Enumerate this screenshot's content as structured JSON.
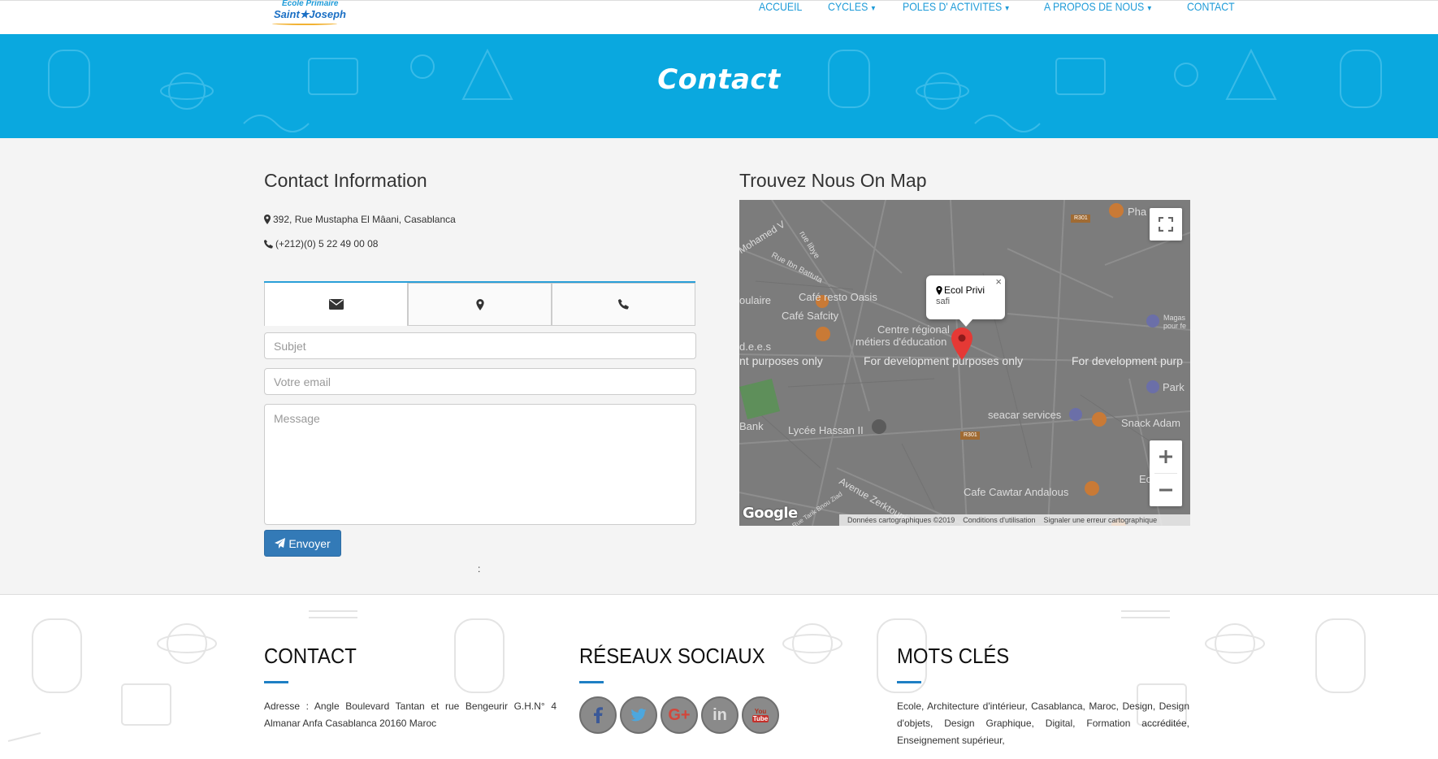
{
  "logo": {
    "line1": "Ecole Primaire",
    "line2": "Saint★Joseph"
  },
  "nav": {
    "items": [
      {
        "label": "ACCUEIL",
        "dropdown": false
      },
      {
        "label": "CYCLES",
        "dropdown": true
      },
      {
        "label": "POLES D' ACTIVITES",
        "dropdown": true
      },
      {
        "label": "A PROPOS DE NOUS",
        "dropdown": true
      },
      {
        "label": "CONTACT",
        "dropdown": false
      }
    ]
  },
  "hero": {
    "title": "Contact"
  },
  "contact_info": {
    "title": "Contact Information",
    "address": "392, Rue Mustapha El Mâani, Casablanca",
    "phone": "(+212)(0) 5 22 49 00 08"
  },
  "form": {
    "tabs": [
      "envelope-icon",
      "map-marker-icon",
      "phone-icon"
    ],
    "subject_placeholder": "Subjet",
    "email_placeholder": "Votre email",
    "message_placeholder": "Message",
    "submit_label": "Envoyer",
    "colon": ":"
  },
  "map": {
    "title": "Trouvez Nous On Map",
    "infowindow_title": "Ecol Privi",
    "infowindow_subtitle": "safi",
    "labels": [
      "Café resto Oasis",
      "Café Safcity",
      "Centre régional",
      "métiers d'éducation",
      "Lycée Hassan II",
      "seacar services",
      "Snack Adam",
      "Cafe Cawtar Andalous",
      "Magas",
      "pour fe",
      "Park",
      "Bank",
      "d.e.e.s",
      "oulaire",
      "Pha",
      "Ec",
      "Mohamed V",
      "Rue Ibn Battuta",
      "rue libye",
      "Avenue Zerktouni",
      "Rue Tarik Bnou Ziad",
      "R301",
      "R301"
    ],
    "dev_watermark": [
      "nt purposes only",
      "For development purposes only",
      "For development purp"
    ],
    "footer": [
      "Données cartographiques ©2019",
      "Conditions d'utilisation",
      "Signaler une erreur cartographique"
    ],
    "google_logo": "Google"
  },
  "footer": {
    "contact": {
      "title": "CONTACT",
      "text": "Adresse : Angle Boulevard Tantan et rue Bengeurir G.H.N° 4 Almanar Anfa Casablanca 20160 Maroc"
    },
    "social": {
      "title": "RÉSEAUX SOCIAUX",
      "icons": [
        "facebook-icon",
        "twitter-icon",
        "google-plus-icon",
        "linkedin-icon",
        "youtube-icon"
      ],
      "youtube_text_1": "You",
      "youtube_text_2": "Tube"
    },
    "keywords": {
      "title": "MOTS CLÉS",
      "text": "Ecole, Architecture d'intérieur, Casablanca, Maroc, Design, Design d'objets, Design Graphique, Digital, Formation accréditée, Enseignement supérieur,"
    }
  },
  "colors": {
    "hero_bg": "#0aa8df",
    "nav_link": "#1e9bd8",
    "button": "#337ab7",
    "map_bg": "#7c7c7c"
  }
}
